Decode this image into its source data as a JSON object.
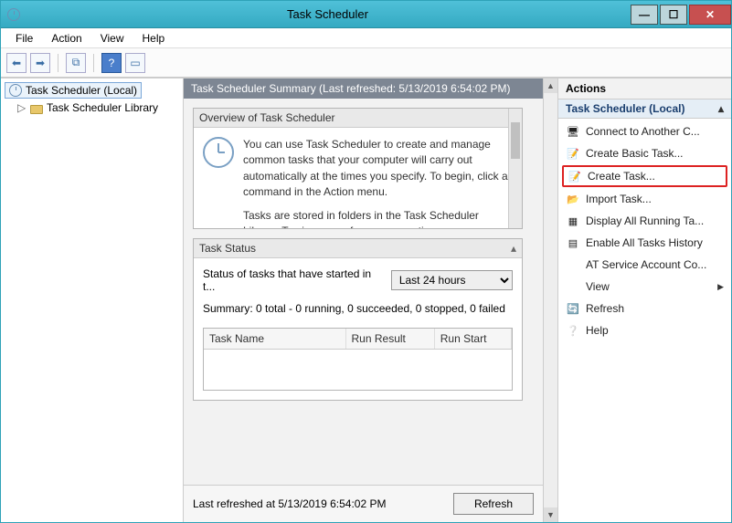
{
  "titlebar": {
    "title": "Task Scheduler"
  },
  "menu": {
    "file": "File",
    "action": "Action",
    "view": "View",
    "help": "Help"
  },
  "tree": {
    "root": "Task Scheduler (Local)",
    "library": "Task Scheduler Library"
  },
  "summary": {
    "header": "Task Scheduler Summary (Last refreshed: 5/13/2019 6:54:02 PM)"
  },
  "overview": {
    "title": "Overview of Task Scheduler",
    "p1": "You can use Task Scheduler to create and manage common tasks that your computer will carry out automatically at the times you specify. To begin, click a command in the Action menu.",
    "p2": "Tasks are stored in folders in the Task Scheduler Library. To view or perform an operation on an"
  },
  "status": {
    "title": "Task Status",
    "label": "Status of tasks that have started in t...",
    "period": "Last 24 hours",
    "summary": "Summary: 0 total - 0 running, 0 succeeded, 0 stopped, 0 failed",
    "cols": {
      "name": "Task Name",
      "result": "Run Result",
      "start": "Run Start"
    }
  },
  "footer": {
    "last": "Last refreshed at 5/13/2019 6:54:02 PM",
    "refresh": "Refresh"
  },
  "actions": {
    "header": "Actions",
    "sub": "Task Scheduler (Local)",
    "items": [
      {
        "label": "Connect to Another C..."
      },
      {
        "label": "Create Basic Task..."
      },
      {
        "label": "Create Task...",
        "highlight": true
      },
      {
        "label": "Import Task..."
      },
      {
        "label": "Display All Running Ta..."
      },
      {
        "label": "Enable All Tasks History"
      },
      {
        "label": "AT Service Account Co..."
      },
      {
        "label": "View",
        "submenu": true
      },
      {
        "label": "Refresh"
      },
      {
        "label": "Help"
      }
    ]
  }
}
